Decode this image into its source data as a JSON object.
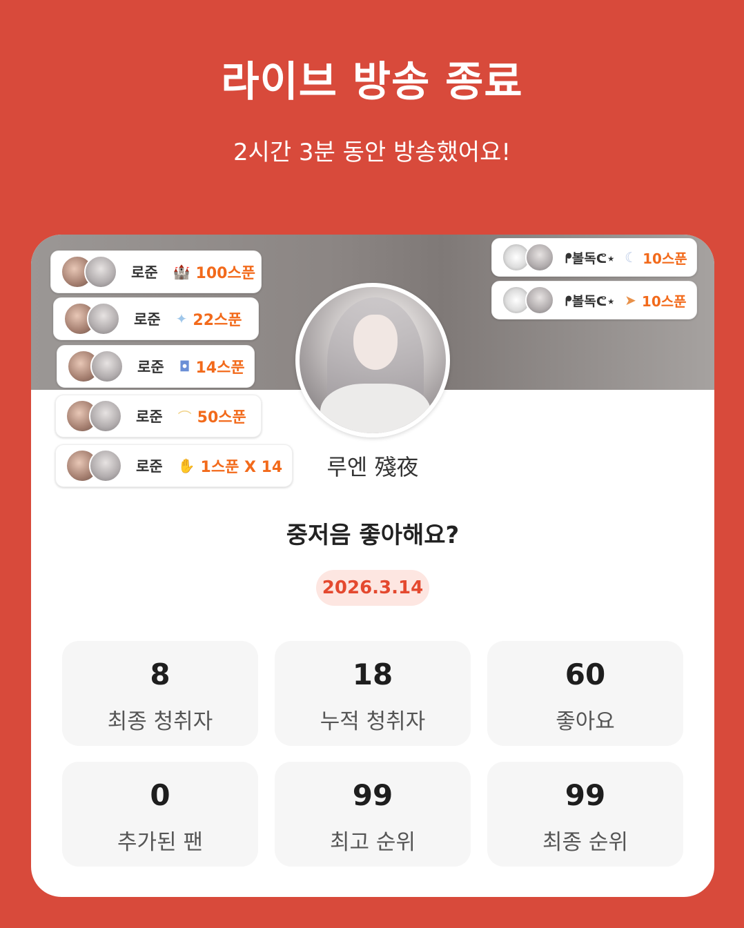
{
  "header": {
    "title": "라이브 방송 종료",
    "subtitle": "2시간 3분 동안 방송했어요!"
  },
  "profile": {
    "nickname": "루엔 殘夜",
    "question": "중저음 좋아해요?",
    "date": "2026.3.14"
  },
  "stats": [
    {
      "value": "8",
      "label": "최종 청취자"
    },
    {
      "value": "18",
      "label": "누적 청취자"
    },
    {
      "value": "60",
      "label": "좋아요"
    },
    {
      "value": "0",
      "label": "추가된 팬"
    },
    {
      "value": "99",
      "label": "최고 순위"
    },
    {
      "value": "99",
      "label": "최종 순위"
    }
  ],
  "gifts_left": [
    {
      "name": "로준",
      "icon": "castle-icon",
      "amount": "100스푼"
    },
    {
      "name": "로준",
      "icon": "sparkle-icon",
      "amount": "22스푼"
    },
    {
      "name": "로준",
      "icon": "cup-icon",
      "amount": "14스푼"
    },
    {
      "name": "로준",
      "icon": "crescent-icon",
      "amount": "50스푼"
    },
    {
      "name": "로준",
      "icon": "hand-icon",
      "amount": "1스푼 X 14"
    }
  ],
  "gifts_right": [
    {
      "name": "ᖰ볼독ᕦ⋆",
      "icon": "moon-icon",
      "amount": "10스푼"
    },
    {
      "name": "ᖰ볼독ᕦ⋆",
      "icon": "carrot-icon",
      "amount": "10스푼"
    }
  ]
}
